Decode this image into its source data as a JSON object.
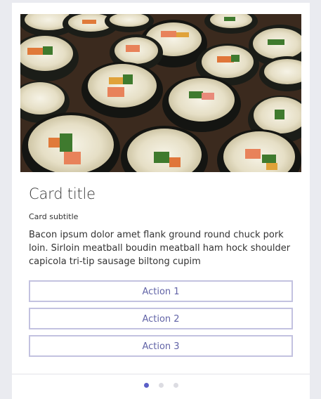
{
  "card": {
    "image_alt": "Sushi rolls",
    "title": "Card title",
    "subtitle": "Card subtitle",
    "body": "Bacon ipsum dolor amet flank ground round chuck pork loin. Sirloin meatball boudin meatball ham hock shoulder capicola tri-tip sausage biltong cupim",
    "actions": [
      {
        "label": "Action 1"
      },
      {
        "label": "Action 2"
      },
      {
        "label": "Action 3"
      }
    ]
  },
  "carousel": {
    "total_pages": 3,
    "current_page": 1
  },
  "colors": {
    "accent": "#6264a7",
    "button_border": "#c3c2e0",
    "active_dot": "#5b5fc7",
    "inactive_dot": "#dcdce2"
  }
}
